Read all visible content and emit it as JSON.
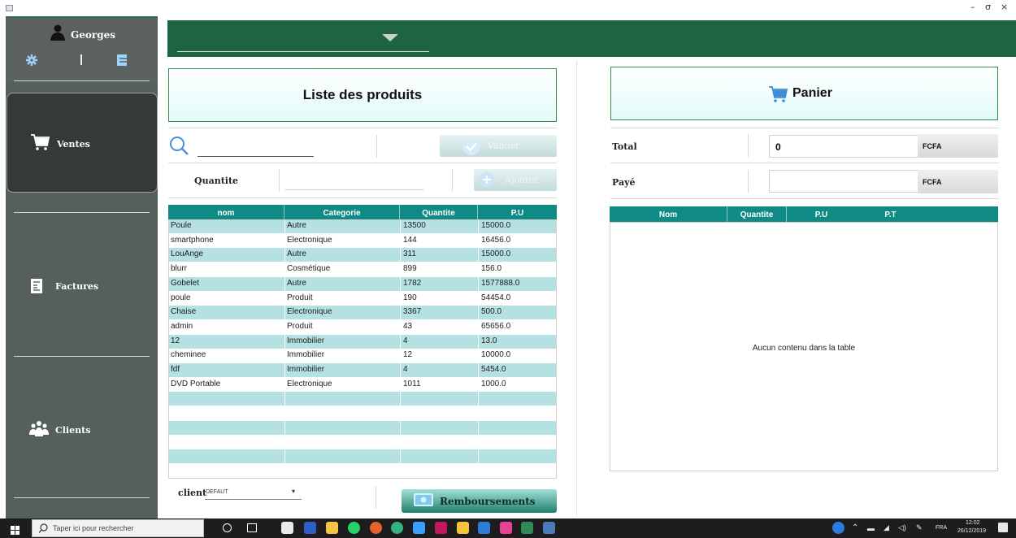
{
  "window": {
    "controls": {
      "minimize": "–",
      "maximize": "σ",
      "close": "×"
    }
  },
  "sidebar": {
    "user": {
      "name": "Georges",
      "icons": [
        "person-icon",
        "gear-icon",
        "logout-icon"
      ],
      "divider": "|"
    },
    "items": [
      {
        "label": "Ventes",
        "icon": "cart-icon",
        "active": true
      },
      {
        "label": "Factures",
        "icon": "invoice-icon",
        "active": false
      },
      {
        "label": "Clients",
        "icon": "people-icon",
        "active": false
      }
    ]
  },
  "products": {
    "title": "Liste des produits",
    "search": {
      "value": ""
    },
    "validate_label": "Valider",
    "quantity_label": "Quantite",
    "quantity_value": "",
    "add_label": "Ajouter",
    "columns": [
      "nom",
      "Categorie",
      "Quantite",
      "P.U"
    ],
    "rows": [
      [
        "Poule",
        "Autre",
        "13500",
        "15000.0"
      ],
      [
        "smartphone",
        "Electronique",
        "144",
        "16456.0"
      ],
      [
        "LouAnge",
        "Autre",
        "311",
        "15000.0"
      ],
      [
        "blurr",
        "Cosmétique",
        "899",
        "156.0"
      ],
      [
        "Gobelet",
        "Autre",
        "1782",
        "1577888.0"
      ],
      [
        "poule",
        "Produit",
        "190",
        "54454.0"
      ],
      [
        "Chaise",
        "Electronique",
        "3367",
        "500.0"
      ],
      [
        "admin",
        "Produit",
        "43",
        "65656.0"
      ],
      [
        "12",
        "Immobilier",
        "4",
        "13.0"
      ],
      [
        "cheminee",
        "Immobilier",
        "12",
        "10000.0"
      ],
      [
        "fdf",
        "Immobilier",
        "4",
        "5454.0"
      ],
      [
        "DVD Portable",
        "Electronique",
        "1011",
        "1000.0"
      ]
    ]
  },
  "cart": {
    "title": "Panier",
    "total_label": "Total",
    "total_value": "0",
    "paid_label": "Payé",
    "paid_value": "",
    "currency": "FCFA",
    "columns": [
      "Nom",
      "Quantite",
      "P.U",
      "P.T"
    ],
    "empty_message": "Aucun contenu dans la table"
  },
  "footer": {
    "client_label": "client",
    "client_value": "DEFAUT",
    "refund_label": "Remboursements"
  },
  "taskbar": {
    "search_placeholder": "Taper ici pour rechercher",
    "language": "FRA",
    "time": "12:02",
    "date": "26/12/2019"
  },
  "colors": {
    "header_green": "#1e6440",
    "table_head": "#0f8a84",
    "row_alt": "#b5e1e3",
    "sidebar": "#555f5b"
  }
}
